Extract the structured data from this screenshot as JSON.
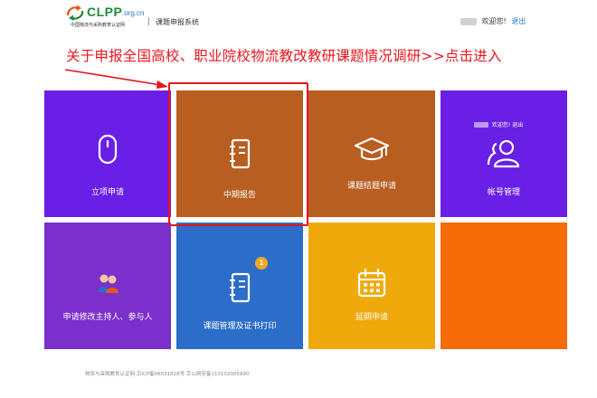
{
  "header": {
    "logo_text": "CLPP",
    "logo_domain": ".org.cn",
    "logo_subtitle": "中国物流与采购教育认证网",
    "system_name": "课题申报系统",
    "welcome": "欢迎您!",
    "logout": "退出"
  },
  "banner": {
    "text": "关于申报全国高校、职业院校物流教改教研课题情况调研>>点击进入"
  },
  "tiles": [
    {
      "label": "立项申请",
      "icon": "mouse-icon",
      "color": "#6a1fe6"
    },
    {
      "label": "中期报告",
      "icon": "notebook-icon",
      "color": "#b85e21"
    },
    {
      "label": "课题结题申请",
      "icon": "graduation-cap-icon",
      "color": "#b85e21"
    },
    {
      "label": "帐号管理",
      "icon": "users-icon",
      "color": "#6a1fe6",
      "overlay_welcome": "欢迎您!",
      "overlay_logout": "退出"
    },
    {
      "label": "申请修改主持人、参与人",
      "icon": "people-icon",
      "color": "#7b2fcc"
    },
    {
      "label": "课题管理及证书打印",
      "icon": "notebook-icon",
      "color": "#2b6dc9",
      "badge": "1"
    },
    {
      "label": "延期申请",
      "icon": "calendar-icon",
      "color": "#f0a90a"
    },
    {
      "label": "",
      "icon": "",
      "color": "#f56b08"
    }
  ],
  "footer": {
    "text": "物流与采购教育认证网:京ICP备06031828号 京公网安备110102005990"
  }
}
